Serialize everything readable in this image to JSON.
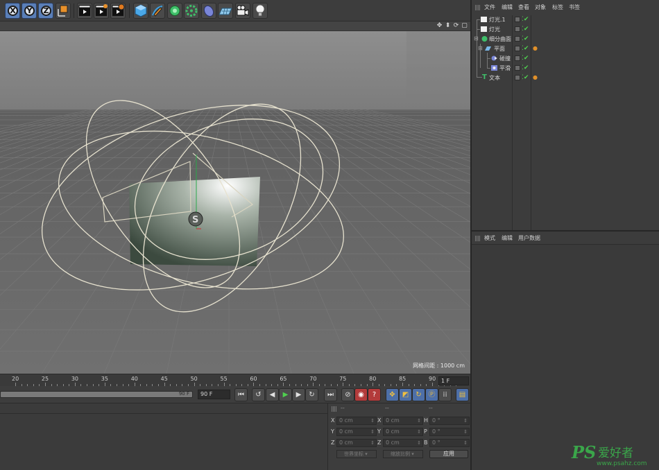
{
  "toolbar": {
    "axis_x": "X",
    "axis_y": "Y",
    "axis_z": "Z",
    "icons": [
      "axis-x-icon",
      "axis-y-icon",
      "axis-z-icon",
      "coordinate-system-icon",
      "render-view-icon",
      "render-picture-viewer-icon",
      "render-settings-icon",
      "cube-icon",
      "pen-icon",
      "subdivision-icon",
      "generator-icon",
      "deformer-icon",
      "floor-icon",
      "camera-icon",
      "light-icon"
    ]
  },
  "viewport": {
    "grid_spacing_label": "网格间距 : 1000 cm"
  },
  "timeline": {
    "ticks": [
      "20",
      "25",
      "30",
      "35",
      "40",
      "45",
      "50",
      "55",
      "60",
      "65",
      "70",
      "75",
      "80",
      "85",
      "90"
    ],
    "current_frame": "1 F"
  },
  "transport": {
    "range_end_label": "90 F",
    "end_frame": "90 F"
  },
  "coordinates": {
    "headers": [
      "--",
      "--",
      "--"
    ],
    "rows": [
      {
        "l1": "X",
        "v1": "0 cm",
        "l2": "X",
        "v2": "0 cm",
        "l3": "H",
        "v3": "0 °"
      },
      {
        "l1": "Y",
        "v1": "0 cm",
        "l2": "Y",
        "v2": "0 cm",
        "l3": "P",
        "v3": "0 °"
      },
      {
        "l1": "Z",
        "v1": "0 cm",
        "l2": "Z",
        "v2": "0 cm",
        "l3": "B",
        "v3": "0 °"
      }
    ],
    "coord_mode": "世界坐标",
    "scale_mode": "缩放比例",
    "apply": "应用"
  },
  "object_manager": {
    "menu": [
      "文件",
      "编辑",
      "查看",
      "对象",
      "标签",
      "书签"
    ],
    "objects": [
      {
        "name": "灯光.1",
        "icon": "light-object-icon",
        "tag": ""
      },
      {
        "name": "灯光",
        "icon": "light-object-icon",
        "tag": ""
      },
      {
        "name": "细分曲面",
        "icon": "subdivision-surface-icon",
        "tag": ""
      },
      {
        "name": "平面",
        "icon": "plane-object-icon",
        "tag": "●"
      },
      {
        "name": "碰撞",
        "icon": "collision-deformer-icon",
        "tag": ""
      },
      {
        "name": "平滑",
        "icon": "smoothing-deformer-icon",
        "tag": ""
      },
      {
        "name": "文本",
        "icon": "text-object-icon",
        "tag": "●"
      }
    ]
  },
  "attribute_manager": {
    "menu": [
      "模式",
      "编辑",
      "用户数据"
    ]
  },
  "watermark": {
    "logo": "PS",
    "chinese": "爱好者",
    "url": "www.psahz.com"
  },
  "colors": {
    "viewport_bg": "#6e6e6e",
    "panel_bg": "#3c3c3c",
    "check_green": "#4fd04f",
    "accent_blue": "#5a7fb8"
  }
}
